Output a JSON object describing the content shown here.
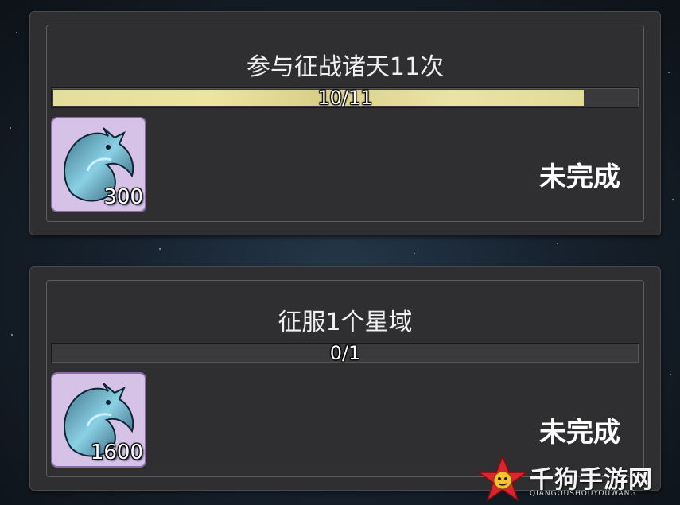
{
  "quests": [
    {
      "title": "参与征战诸天11次",
      "progress_text": "10/11",
      "progress_fraction": 0.909,
      "reward_count": "300",
      "reward_icon": "blue-dragon-emblem-icon",
      "status": "未完成"
    },
    {
      "title": "征服1个星域",
      "progress_text": "0/1",
      "progress_fraction": 0,
      "reward_count": "1600",
      "reward_icon": "blue-dragon-emblem-icon",
      "status": "未完成"
    }
  ],
  "watermark": {
    "name": "千狗手游网",
    "subtitle": "QIANGOUSHOUYOUWANG"
  },
  "colors": {
    "progress_fill": "#e5dd9c",
    "reward_bg": "#d7c2e7",
    "card_bg": "#2f2f31"
  }
}
